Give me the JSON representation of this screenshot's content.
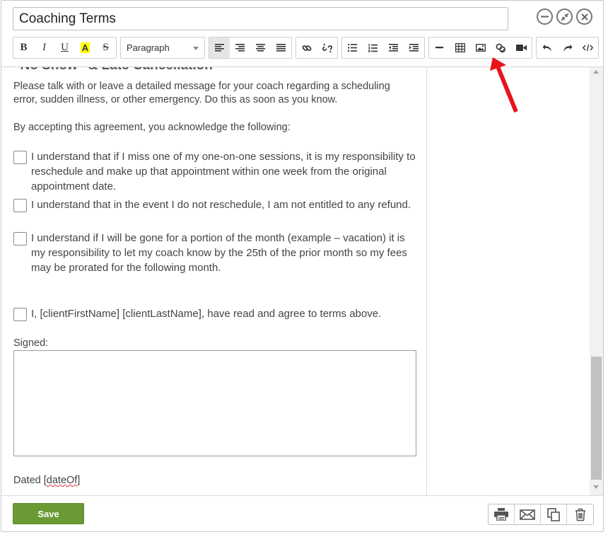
{
  "header": {
    "title_value": "Coaching Terms"
  },
  "toolbar": {
    "bold": "B",
    "italic": "I",
    "underline": "U",
    "highlight": "A",
    "strike": "S",
    "paragraph_value": "Paragraph"
  },
  "content": {
    "partial_heading": "“No Show” & Late Cancellation",
    "para1": "Please talk with or leave a detailed message for your coach regarding a scheduling error, sudden illness, or other emergency.  Do this as soon as you know.",
    "para2": "By accepting this agreement, you acknowledge the following:",
    "checks": [
      "I understand that if I miss one of my one-on-one sessions, it is my responsibility to reschedule and make up that appointment within one week from the original appointment date.",
      "I understand that in the event I do not reschedule, I am not entitled to any refund.",
      "I understand if I will be gone for a portion of the month (example – vacation) it is my responsibility to let my coach know by the 25th of the prior month so my fees may be prorated for the following month.",
      "I, [clientFirstName] [clientLastName], have read and agree to terms above."
    ],
    "signed_label": "Signed:",
    "dated_prefix": "Dated [",
    "dated_token": "dateOf",
    "dated_suffix": "]"
  },
  "footer": {
    "save_label": "Save"
  },
  "colors": {
    "save_green": "#6b9a35",
    "arrow_red": "#e8141c"
  },
  "icons": {
    "toolbar": [
      "align-left-icon",
      "align-right-icon",
      "align-center-icon",
      "align-justify-icon",
      "link-icon",
      "unlink-icon",
      "bullet-list-icon",
      "numbered-list-icon",
      "outdent-icon",
      "indent-icon",
      "horizontal-rule-icon",
      "table-icon",
      "image-icon",
      "merge-field-icon",
      "video-icon",
      "undo-icon",
      "redo-icon",
      "code-icon"
    ],
    "footer": [
      "print-icon",
      "email-icon",
      "copy-icon",
      "trash-icon"
    ]
  }
}
